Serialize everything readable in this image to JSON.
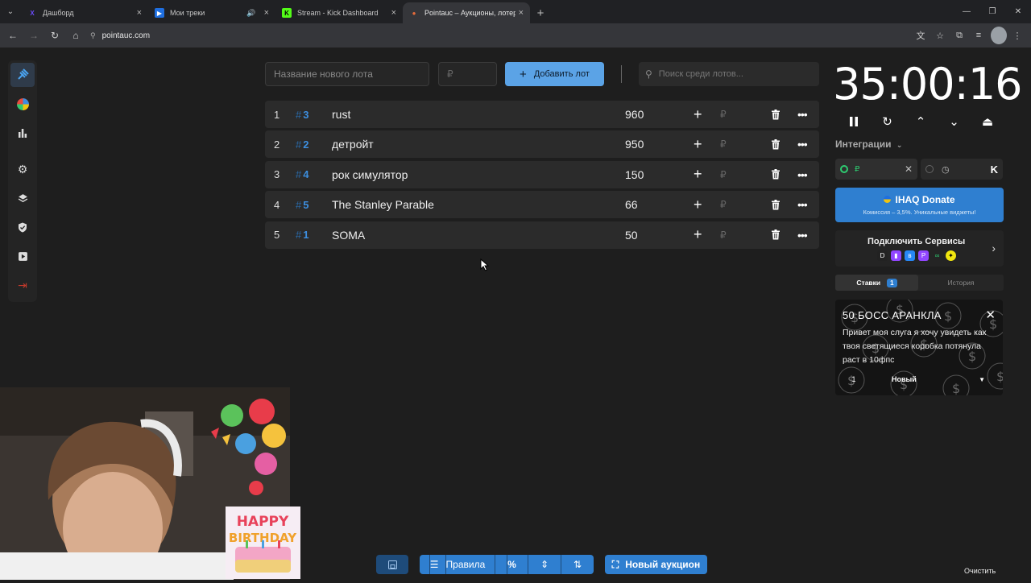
{
  "browser": {
    "tabs": [
      {
        "title": "Дашборд",
        "favicon": "X",
        "favicon_color": "#6b4cff"
      },
      {
        "title": "Мои треки",
        "favicon": "▶",
        "favicon_color": "#1f6fe0"
      },
      {
        "title": "Stream - Kick Dashboard",
        "favicon": "K",
        "favicon_color": "#53fc18"
      },
      {
        "title": "Pointauc – Аукционы, лотереи",
        "favicon": "●",
        "favicon_color": "#e86c3a"
      }
    ],
    "url": "pointauc.com"
  },
  "controls": {
    "lot_name_placeholder": "Название нового лота",
    "price_placeholder": "₽",
    "add_lot_label": "Добавить лот",
    "search_placeholder": "Поиск среди лотов..."
  },
  "lots": [
    {
      "index": "1",
      "number": "3",
      "name": "rust",
      "amount": "960"
    },
    {
      "index": "2",
      "number": "2",
      "name": "детройт",
      "amount": "950"
    },
    {
      "index": "3",
      "number": "4",
      "name": "рок симулятор",
      "amount": "150"
    },
    {
      "index": "4",
      "number": "5",
      "name": " The Stanley Parable",
      "amount": "66"
    },
    {
      "index": "5",
      "number": "1",
      "name": "SOMA",
      "amount": "50"
    }
  ],
  "currency_symbol": "₽",
  "timer": {
    "value": "35:00:16"
  },
  "integrations": {
    "label": "Интеграции",
    "rub": "₽"
  },
  "donate": {
    "title": "IHAQ Donate",
    "subtitle": "Комиссия – 3,5%. Уникальные виджеты!"
  },
  "services": {
    "title": "Подключить Сервисы"
  },
  "bets": {
    "tab_active": "Ставки",
    "tab_active_count": "1",
    "tab_history": "История",
    "card": {
      "title": "50 БОСС АРАНКЛА",
      "message": "Привет моя слуга я хочу увидеть как твоя светящиеся коробка потянула раст в 10фпс",
      "quantity": "1",
      "status": "Новый"
    }
  },
  "bottom": {
    "rules_label": "Правила",
    "percent_label": "%",
    "new_auction_label": "Новый аукцион",
    "clear_label": "Очистить"
  },
  "colors": {
    "accent": "#2f7fd0",
    "lot_number": "#3d8fe0",
    "background": "#1e1e1e"
  }
}
